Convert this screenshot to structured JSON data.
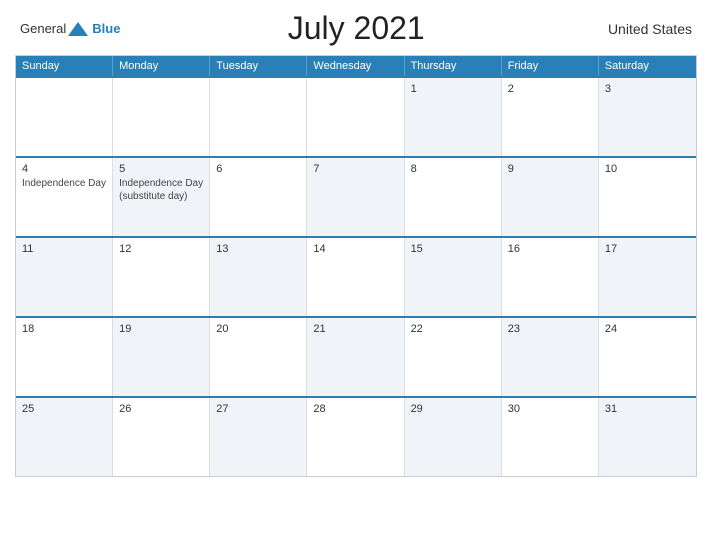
{
  "header": {
    "logo_general": "General",
    "logo_blue": "Blue",
    "month_title": "July 2021",
    "country": "United States"
  },
  "day_headers": [
    "Sunday",
    "Monday",
    "Tuesday",
    "Wednesday",
    "Thursday",
    "Friday",
    "Saturday"
  ],
  "weeks": [
    [
      {
        "day": "",
        "event": "",
        "alt": false
      },
      {
        "day": "",
        "event": "",
        "alt": false
      },
      {
        "day": "",
        "event": "",
        "alt": false
      },
      {
        "day": "",
        "event": "",
        "alt": false
      },
      {
        "day": "1",
        "event": "",
        "alt": true
      },
      {
        "day": "2",
        "event": "",
        "alt": false
      },
      {
        "day": "3",
        "event": "",
        "alt": true
      }
    ],
    [
      {
        "day": "4",
        "event": "Independence Day",
        "alt": false
      },
      {
        "day": "5",
        "event": "Independence Day\n(substitute day)",
        "alt": true
      },
      {
        "day": "6",
        "event": "",
        "alt": false
      },
      {
        "day": "7",
        "event": "",
        "alt": true
      },
      {
        "day": "8",
        "event": "",
        "alt": false
      },
      {
        "day": "9",
        "event": "",
        "alt": true
      },
      {
        "day": "10",
        "event": "",
        "alt": false
      }
    ],
    [
      {
        "day": "11",
        "event": "",
        "alt": true
      },
      {
        "day": "12",
        "event": "",
        "alt": false
      },
      {
        "day": "13",
        "event": "",
        "alt": true
      },
      {
        "day": "14",
        "event": "",
        "alt": false
      },
      {
        "day": "15",
        "event": "",
        "alt": true
      },
      {
        "day": "16",
        "event": "",
        "alt": false
      },
      {
        "day": "17",
        "event": "",
        "alt": true
      }
    ],
    [
      {
        "day": "18",
        "event": "",
        "alt": false
      },
      {
        "day": "19",
        "event": "",
        "alt": true
      },
      {
        "day": "20",
        "event": "",
        "alt": false
      },
      {
        "day": "21",
        "event": "",
        "alt": true
      },
      {
        "day": "22",
        "event": "",
        "alt": false
      },
      {
        "day": "23",
        "event": "",
        "alt": true
      },
      {
        "day": "24",
        "event": "",
        "alt": false
      }
    ],
    [
      {
        "day": "25",
        "event": "",
        "alt": true
      },
      {
        "day": "26",
        "event": "",
        "alt": false
      },
      {
        "day": "27",
        "event": "",
        "alt": true
      },
      {
        "day": "28",
        "event": "",
        "alt": false
      },
      {
        "day": "29",
        "event": "",
        "alt": true
      },
      {
        "day": "30",
        "event": "",
        "alt": false
      },
      {
        "day": "31",
        "event": "",
        "alt": true
      }
    ]
  ],
  "colors": {
    "header_bg": "#2980b9",
    "accent": "#2980b9"
  }
}
